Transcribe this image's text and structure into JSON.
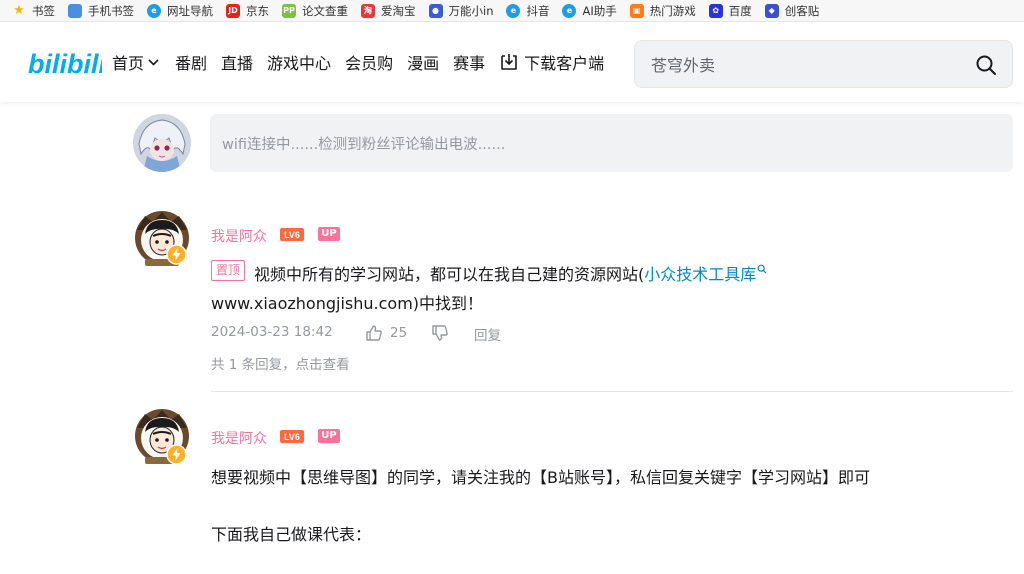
{
  "bookmarks": [
    {
      "label": "书签",
      "icon": "star-icon",
      "color": "#f5b800",
      "glyph": "★"
    },
    {
      "label": "手机书签",
      "icon": "phone-bookmark-icon",
      "color": "#4a90e2",
      "glyph": ""
    },
    {
      "label": "网址导航",
      "icon": "browser-e-icon",
      "color": "#1e9ce8",
      "glyph": "e"
    },
    {
      "label": "京东",
      "icon": "jd-icon",
      "color": "#e1251b",
      "glyph": "JD"
    },
    {
      "label": "论文查重",
      "icon": "pp-icon",
      "color": "#7cc242",
      "glyph": "PP"
    },
    {
      "label": "爱淘宝",
      "icon": "taobao-icon",
      "color": "#e4393c",
      "glyph": "淘"
    },
    {
      "label": "万能小in",
      "icon": "robot-icon",
      "color": "#3b5bdb",
      "glyph": "●"
    },
    {
      "label": "抖音",
      "icon": "browser-e-icon",
      "color": "#1e9ce8",
      "glyph": "e"
    },
    {
      "label": "AI助手",
      "icon": "browser-e-icon",
      "color": "#1e9ce8",
      "glyph": "e"
    },
    {
      "label": "热门游戏",
      "icon": "game-icon",
      "color": "#ff7a1a",
      "glyph": "▣"
    },
    {
      "label": "百度",
      "icon": "baidu-paw-icon",
      "color": "#2932e1",
      "glyph": "✿"
    },
    {
      "label": "创客贴",
      "icon": "chuangketie-icon",
      "color": "#3a4fd8",
      "glyph": "◆"
    }
  ],
  "header": {
    "nav": [
      "首页",
      "番剧",
      "直播",
      "游戏中心",
      "会员购",
      "漫画",
      "赛事",
      "下载客户端"
    ],
    "search_placeholder": "苍穹外卖",
    "brand_color": "#00aeec"
  },
  "comment_input": {
    "placeholder": "wifi连接中......检测到粉丝评论输出电波......"
  },
  "comments": [
    {
      "username": "我是阿众",
      "level": "LV6",
      "up_badge": "UP",
      "pinned_label": "置顶",
      "text_line1_before": "视频中所有的学习网站，都可以在我自己建的资源网站(",
      "link_text": "小众技术工具库",
      "text_line2": "www.xiaozhongjishu.com)中找到！",
      "date": "2024-03-23 18:42",
      "likes": "25",
      "reply_label": "回复",
      "reply_count_text": "共 1 条回复，点击查看"
    },
    {
      "username": "我是阿众",
      "level": "LV6",
      "up_badge": "UP",
      "text_line1": "想要视频中【思维导图】的同学，请关注我的【B站账号】，私信回复关键字【学习网站】即可",
      "text_line2": "下面我自己做课代表："
    }
  ]
}
